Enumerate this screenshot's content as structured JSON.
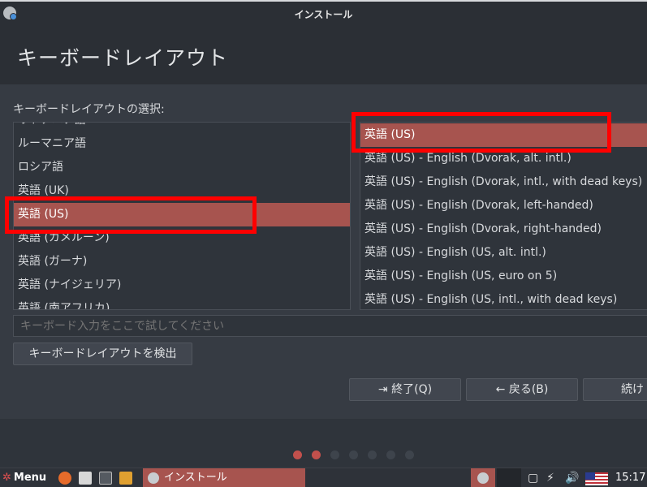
{
  "window": {
    "title": "インストール"
  },
  "header": {
    "title": "キーボードレイアウト"
  },
  "layout_label": "キーボードレイアウトの選択:",
  "languages": [
    {
      "label": "リトアニア語",
      "selected": false
    },
    {
      "label": "ルーマニア語",
      "selected": false
    },
    {
      "label": "ロシア語",
      "selected": false
    },
    {
      "label": "英語 (UK)",
      "selected": false
    },
    {
      "label": "英語 (US)",
      "selected": true
    },
    {
      "label": "英語 (カメルーン)",
      "selected": false
    },
    {
      "label": "英語 (ガーナ)",
      "selected": false
    },
    {
      "label": "英語 (ナイジェリア)",
      "selected": false
    },
    {
      "label": "英語 (南アフリカ)",
      "selected": false
    }
  ],
  "variants": [
    {
      "label": "英語 (US)",
      "selected": true
    },
    {
      "label": "英語 (US) - English (Dvorak, alt. intl.)",
      "selected": false
    },
    {
      "label": "英語 (US) - English (Dvorak, intl., with dead keys)",
      "selected": false
    },
    {
      "label": "英語 (US) - English (Dvorak, left-handed)",
      "selected": false
    },
    {
      "label": "英語 (US) - English (Dvorak, right-handed)",
      "selected": false
    },
    {
      "label": "英語 (US) - English (US, alt. intl.)",
      "selected": false
    },
    {
      "label": "英語 (US) - English (US, euro on 5)",
      "selected": false
    },
    {
      "label": "英語 (US) - English (US, intl., with dead keys)",
      "selected": false
    }
  ],
  "test_input": {
    "placeholder": "キーボード入力をここで試してください"
  },
  "buttons": {
    "detect": "キーボードレイアウトを検出",
    "quit": "終了(Q)",
    "back": "戻る(B)",
    "continue": "続け"
  },
  "progress": {
    "total_steps": 7,
    "current_step": 2
  },
  "taskbar": {
    "menu_label": "Menu",
    "task_label": "インストール",
    "clock": "15:17"
  },
  "colors": {
    "accent": "#a7544f",
    "highlight": "#ff0000",
    "active_dot": "#c2504c"
  }
}
